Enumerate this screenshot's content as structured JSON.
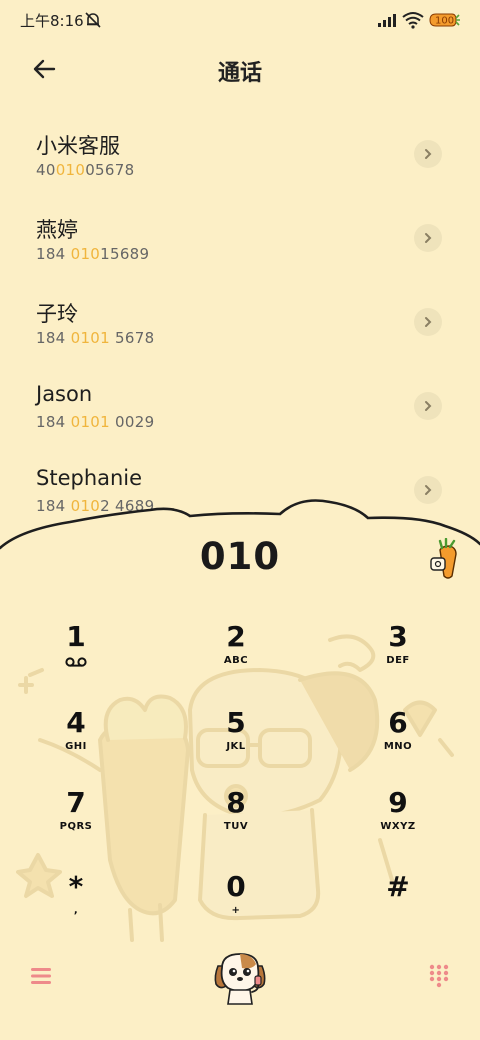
{
  "status": {
    "time": "上午8:16",
    "battery": "100"
  },
  "header": {
    "title": "通话"
  },
  "contacts": [
    {
      "name": "小米客服",
      "num_pre": "40",
      "num_hl": "010",
      "num_post": "05678"
    },
    {
      "name": "燕婷",
      "num_pre": "184 ",
      "num_hl": "010",
      "num_post": "15689"
    },
    {
      "name": "子玲",
      "num_pre": "184 ",
      "num_hl": "0101",
      "num_post": " 5678"
    },
    {
      "name": "Jason",
      "num_pre": "184 ",
      "num_hl": "0101",
      "num_post": " 0029"
    },
    {
      "name": "Stephanie",
      "num_pre": "184 ",
      "num_hl": "010",
      "num_post": "2 4689"
    }
  ],
  "dialer": {
    "input": "010",
    "keys": [
      {
        "digit": "1",
        "letters": ""
      },
      {
        "digit": "2",
        "letters": "ABC"
      },
      {
        "digit": "3",
        "letters": "DEF"
      },
      {
        "digit": "4",
        "letters": "GHI"
      },
      {
        "digit": "5",
        "letters": "JKL"
      },
      {
        "digit": "6",
        "letters": "MNO"
      },
      {
        "digit": "7",
        "letters": "PQRS"
      },
      {
        "digit": "8",
        "letters": "TUV"
      },
      {
        "digit": "9",
        "letters": "WXYZ"
      },
      {
        "digit": "*",
        "letters": ","
      },
      {
        "digit": "0",
        "letters": "+"
      },
      {
        "digit": "#",
        "letters": ""
      }
    ]
  },
  "colors": {
    "background": "#fcefc6",
    "highlight": "#f0b53d",
    "accent": "#ee8a8a"
  }
}
